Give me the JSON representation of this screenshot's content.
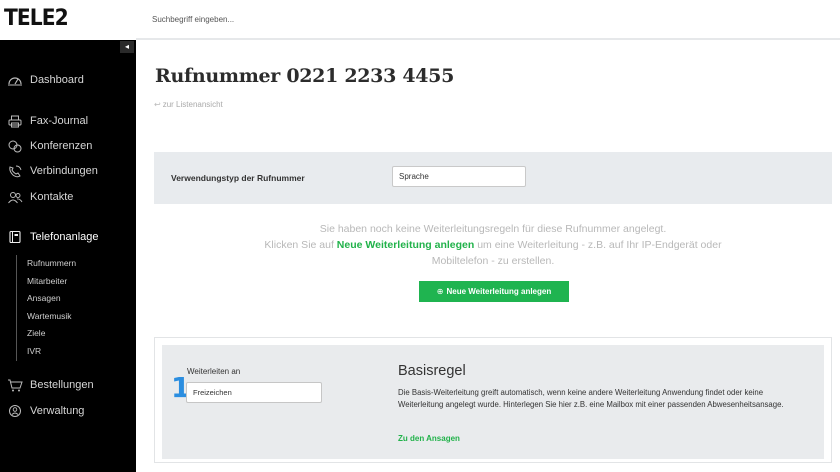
{
  "brand": {
    "logo_text": "TELE2"
  },
  "search": {
    "placeholder": "Suchbegriff eingeben..."
  },
  "sidebar": {
    "collapse_icon": "◂",
    "nav": [
      {
        "label": "Dashboard",
        "icon": "dashboard-gauge-icon"
      },
      {
        "label": "Fax-Journal",
        "icon": "printer-icon"
      },
      {
        "label": "Konferenzen",
        "icon": "conference-icon"
      },
      {
        "label": "Verbindungen",
        "icon": "phone-icon"
      },
      {
        "label": "Kontakte",
        "icon": "contacts-icon"
      },
      {
        "label": "Telefonanlage",
        "icon": "pbx-icon"
      },
      {
        "label": "Bestellungen",
        "icon": "cart-icon"
      },
      {
        "label": "Verwaltung",
        "icon": "admin-icon"
      }
    ],
    "subnav": [
      "Rufnummern",
      "Mitarbeiter",
      "Ansagen",
      "Wartemusik",
      "Ziele",
      "IVR"
    ]
  },
  "page": {
    "title": "Rufnummer  0221 2233 4455",
    "back_link": "zur Listenansicht",
    "usage_label": "Verwendungstyp der Rufnummer",
    "usage_value": "Sprache",
    "empty_line1": "Sie haben noch keine Weiterleitungsregeln für diese Rufnummer angelegt.",
    "empty_line2_pre": "Klicken Sie auf ",
    "empty_line2_link": "Neue Weiterleitung anlegen",
    "empty_line2_post": " um eine Weiterleitung - z.B. auf Ihr IP-Endgerät oder",
    "empty_line3": "Mobiltelefon - zu erstellen.",
    "new_button": "Neue Weiterleitung anlegen",
    "rule": {
      "number": "1",
      "forward_label": "Weiterleiten an",
      "forward_value": "Freizeichen",
      "title": "Basisregel",
      "description": "Die Basis-Weiterleitung greift automatisch, wenn keine andere Weiterleitung Anwendung findet oder keine Weiterleitung angelegt wurde. Hinterlegen Sie hier z.B. eine Mailbox mit einer passenden Abwesenheitsansage.",
      "link": "Zu den Ansagen"
    }
  },
  "colors": {
    "accent_green": "#1fb450",
    "rule_blue": "#2b8ee0",
    "sidebar_bg": "#000000"
  }
}
